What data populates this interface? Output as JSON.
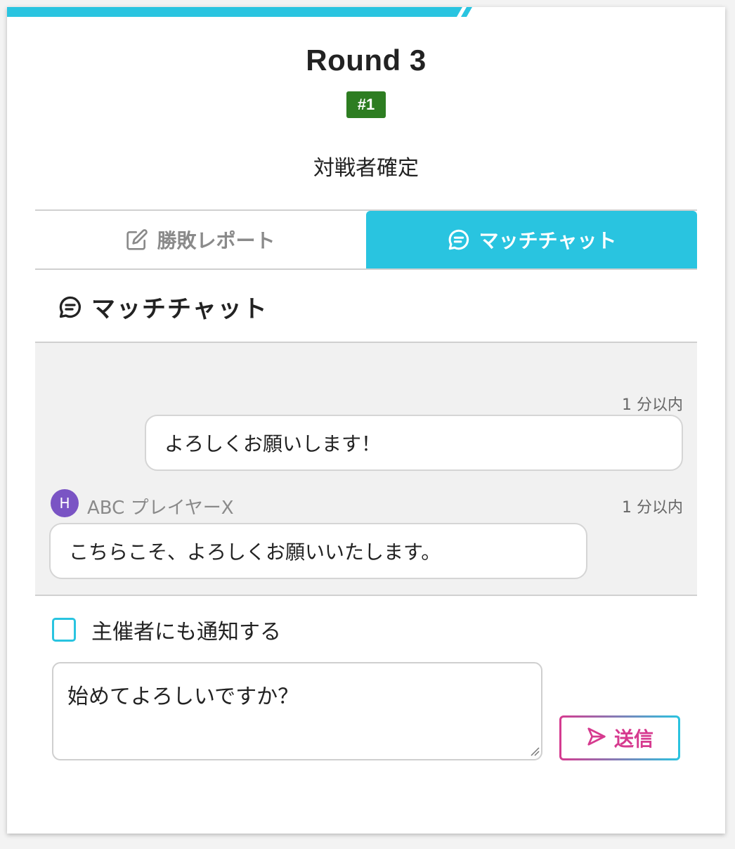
{
  "header": {
    "title": "Round 3",
    "seed": "#1",
    "status": "対戦者確定"
  },
  "tabs": [
    {
      "label": "勝敗レポート",
      "icon": "edit-icon",
      "active": false
    },
    {
      "label": "マッチチャット",
      "icon": "chat-icon",
      "active": true
    }
  ],
  "chat": {
    "heading": "マッチチャット",
    "messages": [
      {
        "time": "1 分以内",
        "text": "よろしくお願いします！",
        "own": true
      },
      {
        "time": "1 分以内",
        "text": "こちらこそ、よろしくお願いいたします。",
        "own": false,
        "avatar": "H",
        "sender": "ABC プレイヤーX"
      }
    ]
  },
  "composer": {
    "notify_label": "主催者にも通知する",
    "notify_checked": false,
    "input_value": "始めてよろしいですか？",
    "send_label": "送信"
  },
  "colors": {
    "accent": "#29c4e0",
    "seed_badge": "#2d7d21",
    "avatar": "#7a54c4",
    "send": "#d63a8f"
  }
}
